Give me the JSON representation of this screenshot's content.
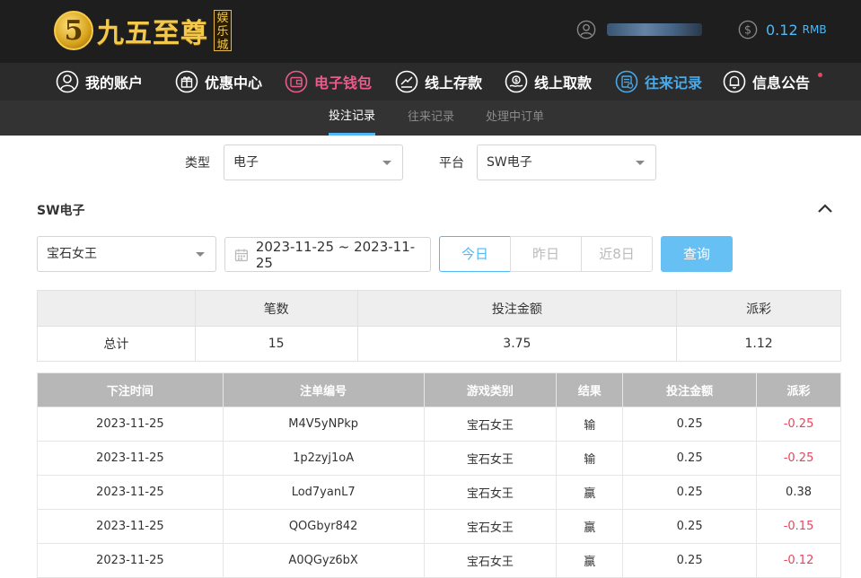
{
  "header": {
    "logo_mark": "5",
    "logo_text": "九五至尊",
    "logo_tag": "娱乐城",
    "balance_value": "0.12",
    "balance_unit": "RMB"
  },
  "nav": {
    "items": [
      {
        "label": "我的账户",
        "icon": "user-icon"
      },
      {
        "label": "优惠中心",
        "icon": "gift-icon"
      },
      {
        "label": "电子钱包",
        "icon": "wallet-icon"
      },
      {
        "label": "线上存款",
        "icon": "deposit-icon"
      },
      {
        "label": "线上取款",
        "icon": "withdraw-icon"
      },
      {
        "label": "往来记录",
        "icon": "records-icon"
      },
      {
        "label": "信息公告",
        "icon": "bell-icon"
      }
    ],
    "colors": {
      "default": "#ffffff",
      "wallet": "#ea5b8d",
      "active": "#4aa9e8"
    }
  },
  "subnav": {
    "tabs": [
      "投注记录",
      "往来记录",
      "处理中订单"
    ]
  },
  "filters": {
    "type_label": "类型",
    "type_value": "电子",
    "platform_label": "平台",
    "platform_value": "SW电子"
  },
  "section": {
    "title": "SW电子",
    "game_value": "宝石女王",
    "date_range": "2023-11-25 ~ 2023-11-25",
    "quick_ranges": [
      "今日",
      "昨日",
      "近8日"
    ],
    "query_label": "查询"
  },
  "summary": {
    "headers": [
      "",
      "笔数",
      "投注金额",
      "派彩"
    ],
    "row": [
      "总计",
      "15",
      "3.75",
      "1.12"
    ]
  },
  "records": {
    "headers": [
      "下注时间",
      "注单编号",
      "游戏类别",
      "结果",
      "投注金额",
      "派彩"
    ],
    "rows": [
      [
        "2023-11-25",
        "M4V5yNPkp",
        "宝石女王",
        "输",
        "0.25",
        "-0.25"
      ],
      [
        "2023-11-25",
        "1p2zyj1oA",
        "宝石女王",
        "输",
        "0.25",
        "-0.25"
      ],
      [
        "2023-11-25",
        "Lod7yanL7",
        "宝石女王",
        "赢",
        "0.25",
        "0.38"
      ],
      [
        "2023-11-25",
        "QOGbyr842",
        "宝石女王",
        "赢",
        "0.25",
        "-0.15"
      ],
      [
        "2023-11-25",
        "A0QGyz6bX",
        "宝石女王",
        "赢",
        "0.25",
        "-0.12"
      ]
    ]
  },
  "colors": {
    "accent": "#4fb8f5",
    "negative": "#e8455d",
    "gold": "#f2c94c"
  }
}
